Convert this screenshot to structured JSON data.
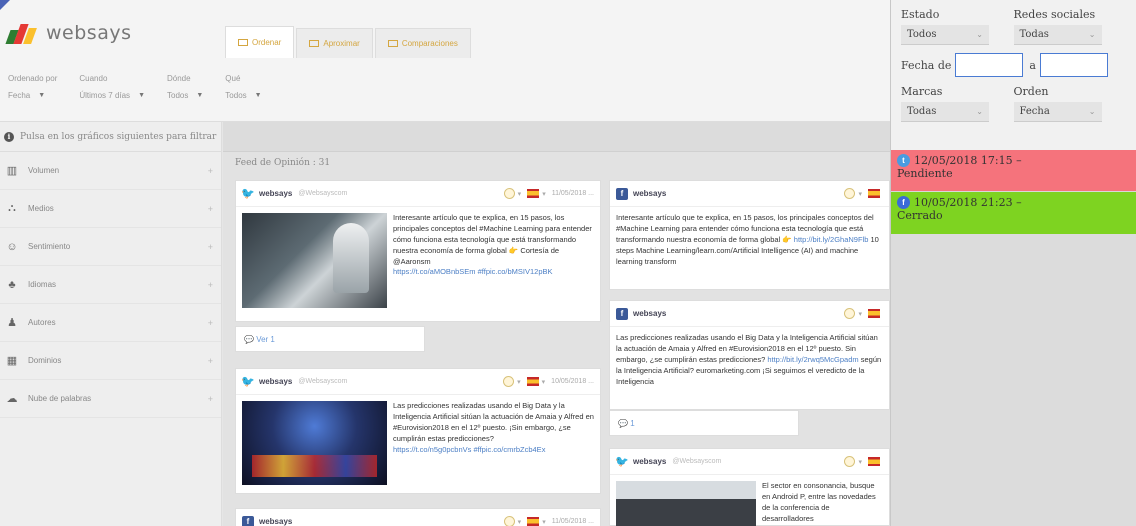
{
  "header": {
    "logo_text": "websays",
    "tabs": [
      {
        "label": "Ordenar",
        "active": true
      },
      {
        "label": "Aproximar",
        "active": false
      },
      {
        "label": "Comparaciones",
        "active": false
      }
    ],
    "filters": [
      {
        "label": "Ordenado por",
        "value": "Fecha"
      },
      {
        "label": "Cuando",
        "value": "Últimos 7 días"
      },
      {
        "label": "Dónde",
        "value": "Todos"
      },
      {
        "label": "Qué",
        "value": "Todos"
      }
    ]
  },
  "sidebar": {
    "hint": "Pulsa en los gráficos siguientes para filtrar",
    "items": [
      {
        "label": "Volumen",
        "icon": "chart-icon"
      },
      {
        "label": "Medios",
        "icon": "sitemap-icon"
      },
      {
        "label": "Sentimiento",
        "icon": "smile-icon"
      },
      {
        "label": "Idiomas",
        "icon": "globe-icon"
      },
      {
        "label": "Autores",
        "icon": "user-icon"
      },
      {
        "label": "Dominios",
        "icon": "domain-icon"
      },
      {
        "label": "Nube de palabras",
        "icon": "cloud-icon"
      }
    ]
  },
  "feed": {
    "title": "Feed de Opinión : 31",
    "cards": [
      {
        "network": "twitter",
        "user": "websays",
        "sub": "@Websayscom",
        "date": "11/05/2018 ...",
        "text": "Interesante artículo que te explica, en 15 pasos, los principales conceptos del #Machine Learning para entender cómo funciona esta tecnología que está transformando nuestra economía de forma global 👉 Cortesía de @Aaronsm",
        "link": "https://t.co/aMOBnbSEm #ffpic.co/bMSIV12pBK"
      },
      {
        "network": "facebook",
        "user": "websays",
        "text": "Interesante artículo que te explica, en 15 pasos, los principales conceptos del #Machine Learning para entender cómo funciona esta tecnología que está transformando nuestra economía de forma global 👉",
        "link": "http://bit.ly/2GhaN9Flb",
        "text2": "10 steps Machine Learning/learn.com/Artificial Intelligence (AI) and machine learning transform"
      },
      {
        "network": "twitter",
        "user": "websays",
        "sub": "@Websayscom",
        "date": "10/05/2018 ...",
        "text": "Las predicciones realizadas usando el Big Data y la Inteligencia Artificial sitúan la actuación de Amaia y Alfred en #Eurovision2018 en el 12º puesto. ¡Sin embargo, ¿se cumplirán estas predicciones?",
        "link": "https://t.co/n5g0pcbnVs #ffpic.co/cmrbZcb4Ex"
      },
      {
        "network": "facebook",
        "user": "websays",
        "text": "Las predicciones realizadas usando el Big Data y la Inteligencia Artificial sitúan la actuación de Amaia y Alfred en #Eurovision2018 en el 12º puesto. Sin embargo, ¿se cumplirán estas predicciones?",
        "link": "http://bit.ly/2rwq5McGpadm",
        "text2": "según la Inteligencia Artificial? euromarketing.com ¡Si seguimos el veredicto de la Inteligencia"
      },
      {
        "network": "twitter",
        "user": "websays",
        "sub": "@Websayscom",
        "text": "El sector en consonancia, busque en Android P, entre las novedades de la conferencia de desarrolladores"
      },
      {
        "network": "facebook",
        "user": "websays",
        "date": "11/05/2018 ..."
      }
    ],
    "reply_label": "Ver 1",
    "reply_label_2": "1"
  },
  "panel": {
    "estado_label": "Estado",
    "estado_value": "Todos",
    "redes_label": "Redes sociales",
    "redes_value": "Todas",
    "fecha_label": "Fecha de",
    "a_label": "a",
    "marcas_label": "Marcas",
    "marcas_value": "Todas",
    "orden_label": "Orden",
    "orden_value": "Fecha",
    "tickets": [
      {
        "network": "twitter",
        "datetime": "12/05/2018 17:15 –",
        "status": "Pendiente",
        "color": "#f5737c"
      },
      {
        "network": "facebook",
        "datetime": "10/05/2018 21:23 –",
        "status": "Cerrado",
        "color": "#7ed321"
      }
    ]
  },
  "colors": {
    "accent_blue": "#4a7bd3",
    "pending": "#f5737c",
    "closed": "#7ed321",
    "facebook": "#3b5998",
    "twitter": "#2b8be0"
  }
}
